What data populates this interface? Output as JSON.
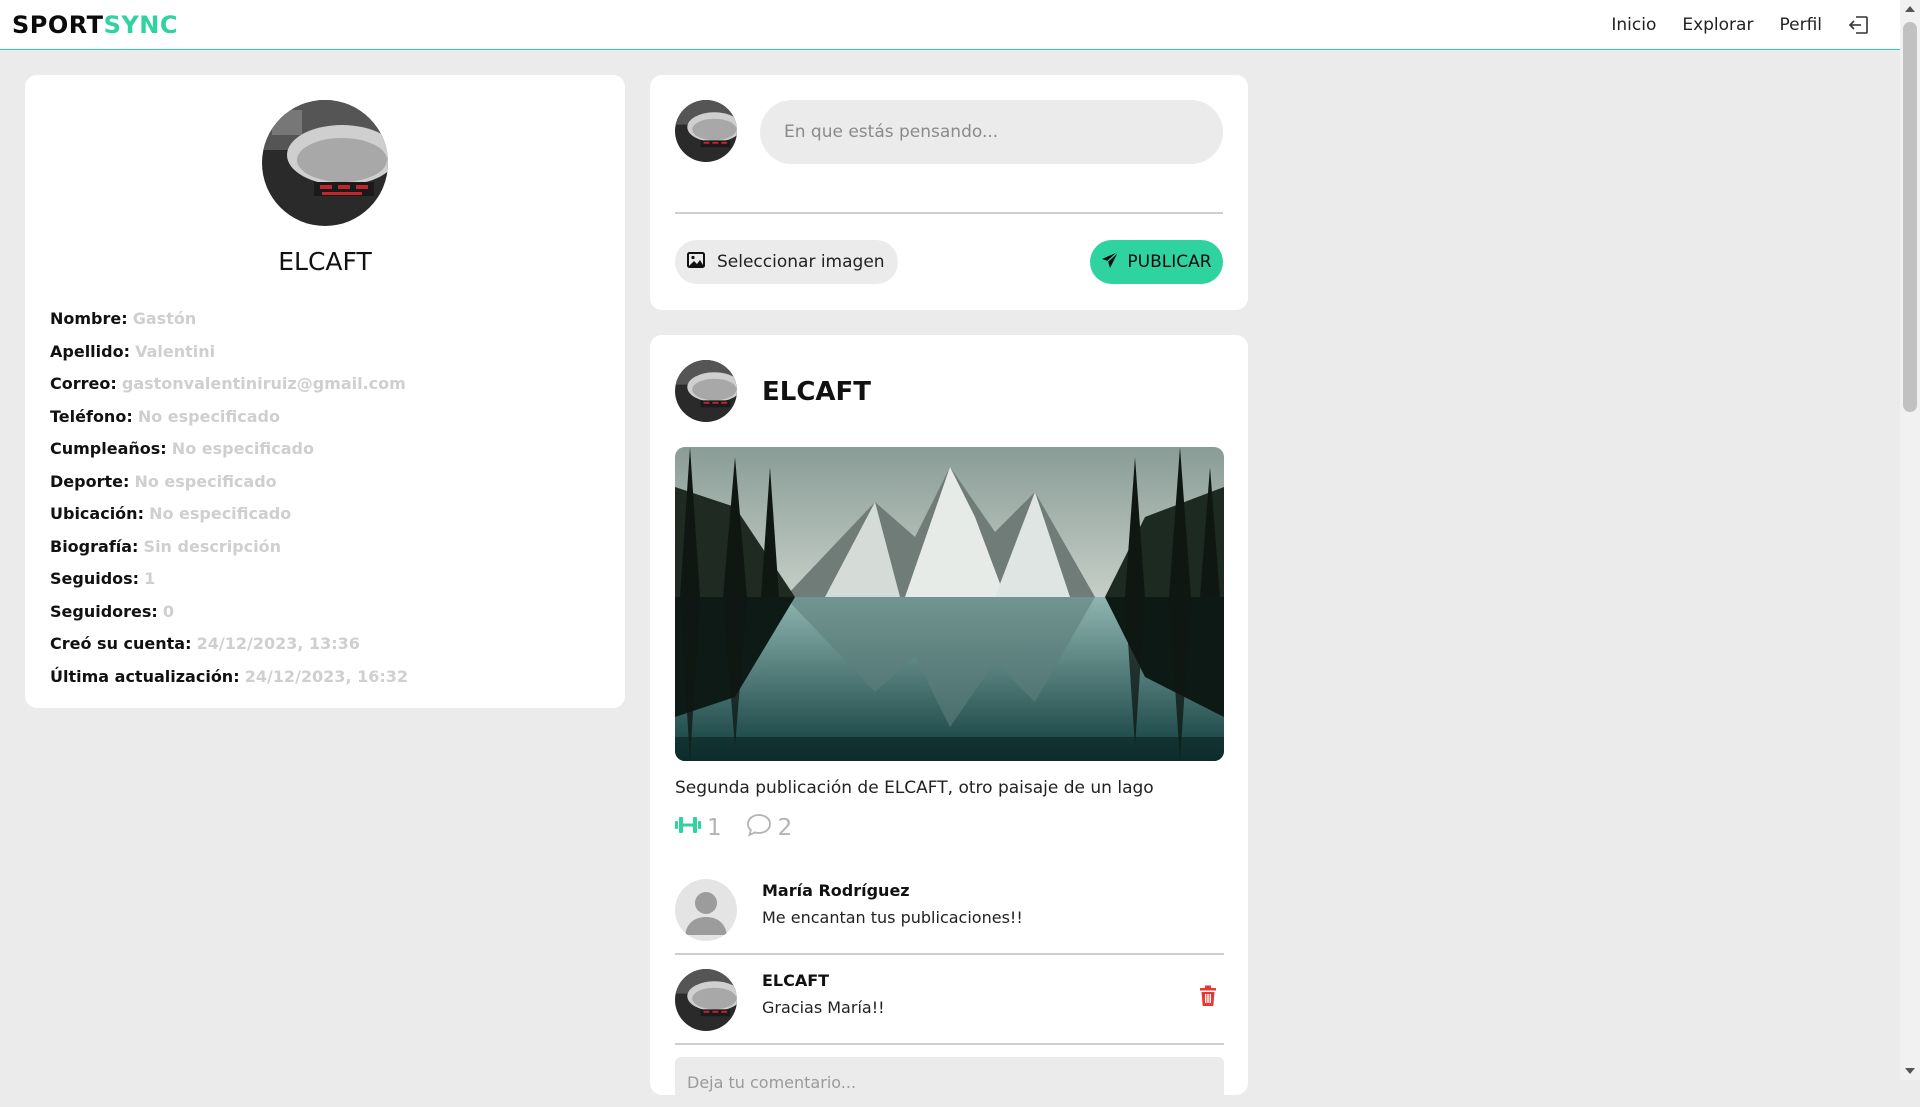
{
  "brand": {
    "part1": "SPORT",
    "part2": "SYNC",
    "accent": "#2fd3a0"
  },
  "nav": {
    "home": "Inicio",
    "explore": "Explorar",
    "profile": "Perfil",
    "logout_icon": "logout-icon"
  },
  "profile": {
    "username": "ELCAFT",
    "fields": [
      {
        "label": "Nombre:",
        "value": "Gastón"
      },
      {
        "label": "Apellido:",
        "value": "Valentini"
      },
      {
        "label": "Correo:",
        "value": "gastonvalentiniruiz@gmail.com"
      },
      {
        "label": "Teléfono:",
        "value": "No especificado"
      },
      {
        "label": "Cumpleaños:",
        "value": "No especificado"
      },
      {
        "label": "Deporte:",
        "value": "No especificado"
      },
      {
        "label": "Ubicación:",
        "value": "No especificado"
      },
      {
        "label": "Biografía:",
        "value": "Sin descripción"
      },
      {
        "label": "Seguidos:",
        "value": "1"
      },
      {
        "label": "Seguidores:",
        "value": "0"
      },
      {
        "label": "Creó su cuenta:",
        "value": "24/12/2023, 13:36"
      },
      {
        "label": "Última actualización:",
        "value": "24/12/2023, 16:32"
      }
    ]
  },
  "composer": {
    "placeholder": "En que estás pensando...",
    "select_image": "Seleccionar imagen",
    "publish": "PUBLICAR"
  },
  "post": {
    "author": "ELCAFT",
    "text": "Segunda publicación de ELCAFT, otro paisaje de un lago",
    "likes": "1",
    "comments_count": "2",
    "comments": [
      {
        "name": "María Rodríguez",
        "text": "Me encantan tus publicaciones!!"
      },
      {
        "name": "ELCAFT",
        "text": "Gracias María!!"
      }
    ],
    "comment_placeholder": "Deja tu comentario..."
  }
}
